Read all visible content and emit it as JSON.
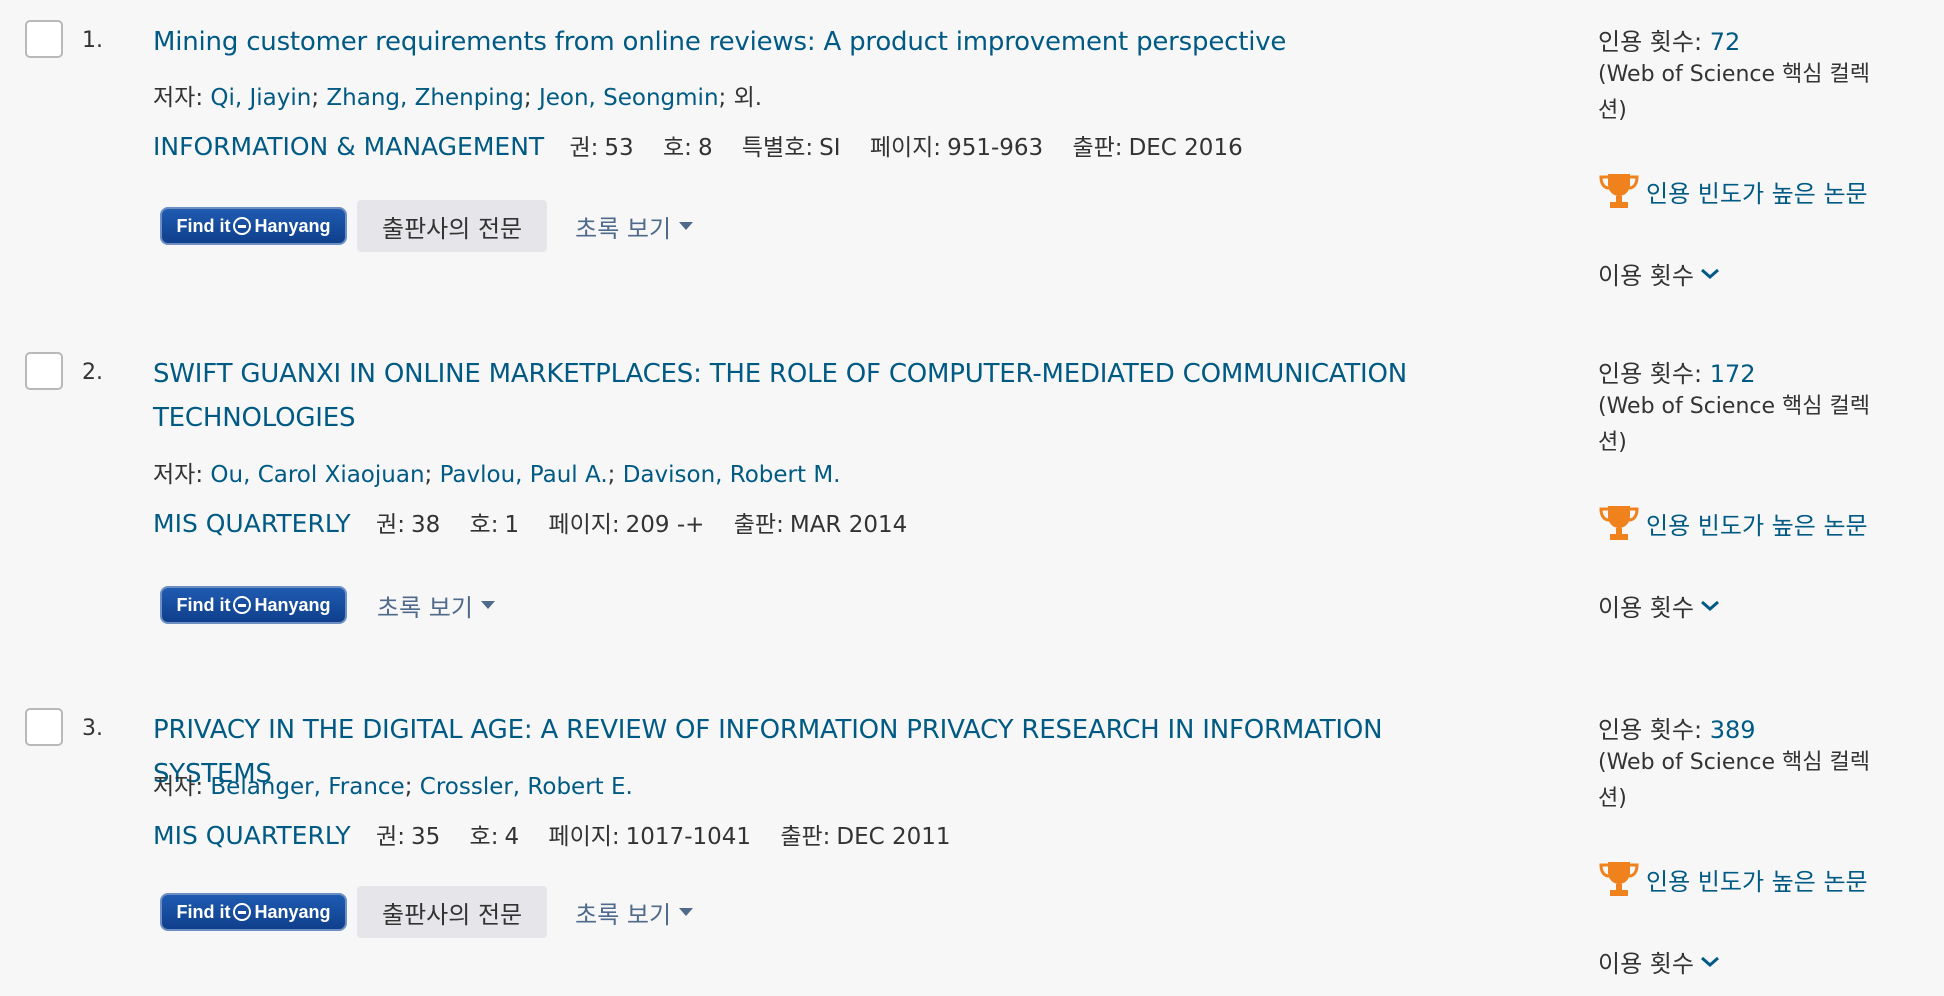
{
  "records": [
    {
      "index": "1.",
      "title": "Mining customer requirements from online reviews: A product improvement perspective",
      "authors_label": "저자:",
      "authors": [
        "Qi, Jiayin",
        "Zhang, Zhenping",
        "Jeon, Seongmin"
      ],
      "authors_suffix": "; 외.",
      "journal": "INFORMATION & MANAGEMENT",
      "meta": [
        {
          "k": "권:",
          "v": "53"
        },
        {
          "k": "호:",
          "v": "8"
        },
        {
          "k": "특별호:",
          "v": "SI"
        },
        {
          "k": "페이지:",
          "v": "951-963"
        },
        {
          "k": "출판:",
          "v": "DEC 2016"
        }
      ],
      "findit_label": "Find it",
      "findit_brand": "Hanyang",
      "publisher_label": "출판사의 전문",
      "abstract_label": "초록 보기",
      "citations_label": "인용 횟수:",
      "citations": "72",
      "citations_source": "(Web of Science 핵심 컬렉션)",
      "highly_cited_label": "인용 빈도가 높은 논문",
      "usage_label": "이용 횟수"
    },
    {
      "index": "2.",
      "title": "SWIFT GUANXI IN ONLINE MARKETPLACES: THE ROLE OF COMPUTER-MEDIATED COMMUNICATION TECHNOLOGIES",
      "authors_label": "저자:",
      "authors": [
        "Ou, Carol Xiaojuan",
        "Pavlou, Paul A.",
        "Davison, Robert M."
      ],
      "authors_suffix": "",
      "journal": "MIS QUARTERLY",
      "meta": [
        {
          "k": "권:",
          "v": "38"
        },
        {
          "k": "호:",
          "v": "1"
        },
        {
          "k": "페이지:",
          "v": "209 -+"
        },
        {
          "k": "출판:",
          "v": "MAR 2014"
        }
      ],
      "findit_label": "Find it",
      "findit_brand": "Hanyang",
      "publisher_label": "",
      "abstract_label": "초록 보기",
      "citations_label": "인용 횟수:",
      "citations": "172",
      "citations_source": "(Web of Science 핵심 컬렉션)",
      "highly_cited_label": "인용 빈도가 높은 논문",
      "usage_label": "이용 횟수"
    },
    {
      "index": "3.",
      "title": "PRIVACY IN THE DIGITAL AGE: A REVIEW OF INFORMATION PRIVACY RESEARCH IN INFORMATION SYSTEMS",
      "authors_label": "저자:",
      "authors": [
        "Belanger, France",
        "Crossler, Robert E."
      ],
      "authors_suffix": "",
      "journal": "MIS QUARTERLY",
      "meta": [
        {
          "k": "권:",
          "v": "35"
        },
        {
          "k": "호:",
          "v": "4"
        },
        {
          "k": "페이지:",
          "v": "1017-1041"
        },
        {
          "k": "출판:",
          "v": "DEC 2011"
        }
      ],
      "findit_label": "Find it",
      "findit_brand": "Hanyang",
      "publisher_label": "출판사의 전문",
      "abstract_label": "초록 보기",
      "citations_label": "인용 횟수:",
      "citations": "389",
      "citations_source": "(Web of Science 핵심 컬렉션)",
      "highly_cited_label": "인용 빈도가 높은 논문",
      "usage_label": "이용 횟수"
    }
  ],
  "colors": {
    "link": "#005a84",
    "trophy": "#f0821e",
    "findit_bg": "#1f5bb1"
  },
  "icons": {
    "trophy": "trophy-icon",
    "caret": "caret-down-icon",
    "chevron": "chevron-down-icon",
    "findit_logo": "hanyang-logo-icon"
  }
}
